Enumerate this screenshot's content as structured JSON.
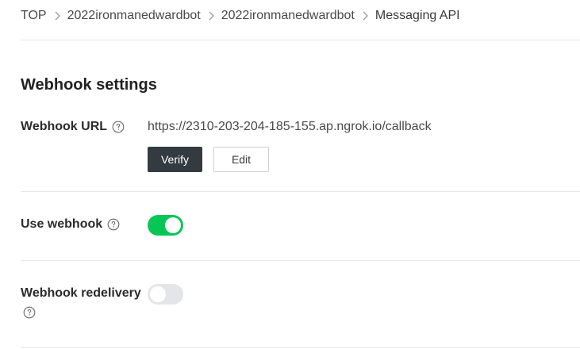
{
  "breadcrumb": {
    "items": [
      {
        "label": "TOP"
      },
      {
        "label": "2022ironmanedwardbot"
      },
      {
        "label": "2022ironmanedwardbot"
      },
      {
        "label": "Messaging API"
      }
    ]
  },
  "webhook_settings": {
    "title": "Webhook settings",
    "webhook_url": {
      "label": "Webhook URL",
      "value": "https://2310-203-204-185-155.ap.ngrok.io/callback",
      "verify_label": "Verify",
      "edit_label": "Edit"
    },
    "use_webhook": {
      "label": "Use webhook",
      "enabled": true
    },
    "webhook_redelivery": {
      "label": "Webhook redelivery",
      "enabled": false
    }
  },
  "colors": {
    "toggle_on": "#06c755",
    "toggle_off": "#e3e5e8",
    "verify_button": "#333a40"
  },
  "icons": {
    "help": "question-circle-icon",
    "separator": "chevron-right-icon"
  }
}
